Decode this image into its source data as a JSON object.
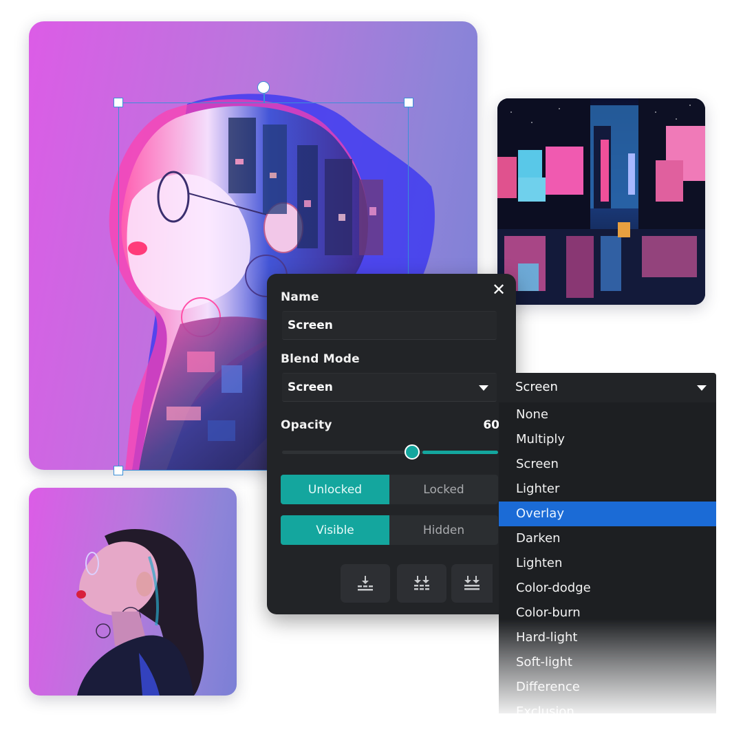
{
  "canvas": {
    "main_image": {
      "subject": "double-exposure portrait of woman in profile with city overlay",
      "background_gradient": [
        "#dc5ce6",
        "#7b7fd6"
      ]
    },
    "city_image": {
      "subject": "neon city street at night with wet reflections"
    },
    "small_image": {
      "subject": "woman in profile with glasses and ponytail on purple background"
    }
  },
  "panel": {
    "close_label": "✕",
    "name_label": "Name",
    "name_value": "Screen",
    "blend_label": "Blend Mode",
    "blend_value": "Screen",
    "opacity_label": "Opacity",
    "opacity_value": "60",
    "opacity_percent": 60,
    "lock_toggle": {
      "options": [
        "Unlocked",
        "Locked"
      ],
      "active": "Unlocked"
    },
    "visibility_toggle": {
      "options": [
        "Visible",
        "Hidden"
      ],
      "active": "Visible"
    },
    "actions": [
      {
        "icon": "merge-down-icon"
      },
      {
        "icon": "merge-visible-icon"
      },
      {
        "icon": "flatten-icon"
      }
    ],
    "accent_color": "#14a69e"
  },
  "dropdown": {
    "selected": "Screen",
    "highlighted": "Overlay",
    "options": [
      "None",
      "Multiply",
      "Screen",
      "Lighter",
      "Overlay",
      "Darken",
      "Lighten",
      "Color-dodge",
      "Color-burn",
      "Hard-light",
      "Soft-light",
      "Difference",
      "Exclusion"
    ],
    "highlight_color": "#1b6bd6"
  }
}
